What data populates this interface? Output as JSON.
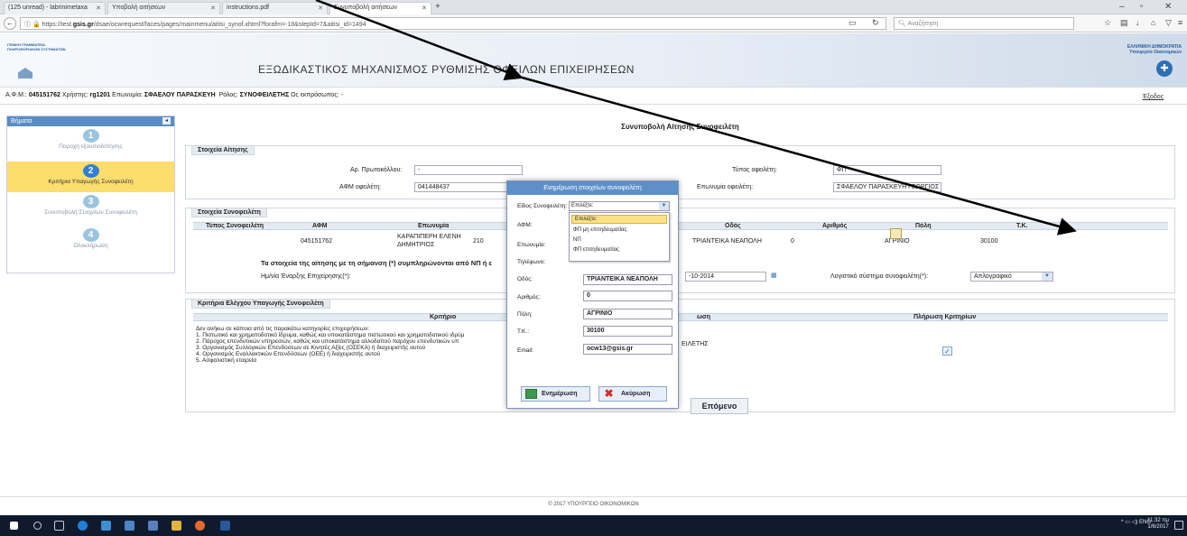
{
  "browser": {
    "tabs": [
      {
        "label": "(125 unread) - labrinimetaxa",
        "active": false
      },
      {
        "label": "Υποβολή αιτήσεων",
        "active": false
      },
      {
        "label": "instructions.pdf",
        "active": false
      },
      {
        "label": "Συνυποβολή αιτήσεων",
        "active": true
      }
    ],
    "url_prefix": "https://test.",
    "url_domain": "gsis.gr",
    "url_path": "/dsae/ocwrequest/faces/pages/mainmenu/aitisi_synof.xhtml?forafm=-18&stepId=7&aitisi_id=1494",
    "search_placeholder": "Αναζήτηση"
  },
  "header": {
    "left_logo_line1": "ΓΕΝΙΚΗ ΓΡΑΜΜΑΤΕΙΑ",
    "left_logo_line2": "ΠΛΗΡΟΦΟΡΙΑΚΩΝ ΣΥΣΤΗΜΑΤΩΝ",
    "title": "ΕΞΩΔΙΚΑΣΤΙΚΟΣ ΜΗΧΑΝΙΣΜΟΣ ΡΥΘΜΙΣΗΣ ΟΦΕΙΛΩΝ ΕΠΙΧΕΙΡΗΣΕΩΝ",
    "right_logo_line1": "ΕΛΛΗΝΙΚΗ ΔΗΜΟΚΡΑΤΙΑ",
    "right_logo_line2": "Υπουργείο Οικονομικών"
  },
  "userbar": {
    "afm_label": "Α.Φ.Μ.:",
    "afm": "045151762",
    "user_label": "Χρήστης:",
    "user": "rg1201",
    "name_label": "Επωνυμία:",
    "name": "ΣΦΑΕΛΟΥ ΠΑΡΑΣΚΕΥΗ",
    "role_label": "Ρόλος:",
    "role": "ΣΥΝΟΦΕΙΛΕΤΗΣ",
    "rep_label": "Ως εκπρόσωπος: -",
    "logout": "Έξοδος"
  },
  "steps": {
    "title": "Βήματα",
    "items": [
      {
        "num": "1",
        "label": "Παροχή εξουσιοδότησης"
      },
      {
        "num": "2",
        "label": "Κριτήρια Υπαγωγής Συνοφειλέτη"
      },
      {
        "num": "3",
        "label": "Συνυποβολή Στοιχείων Συνοφειλέτη"
      },
      {
        "num": "4",
        "label": "Ολοκλήρωση"
      }
    ],
    "current": 2
  },
  "main": {
    "title": "Συνυποβολή Αίτησης Συνοφειλέτη",
    "application": {
      "heading": "Στοιχεία Αίτησης",
      "protocol_label": "Αρ. Πρωτοκόλλου:",
      "protocol_value": "-",
      "debtor_type_label": "Τύπος οφειλέτη:",
      "debtor_type_value": "ΦΠ",
      "debtor_afm_label": "ΑΦΜ οφειλέτη:",
      "debtor_afm_value": "041448437",
      "debtor_name_label": "Επωνυμία οφειλέτη:",
      "debtor_name_value": "ΣΦΑΕΛΟΥ ΠΑΡΑΣΚΕΥΗ ΓΕΩΡΓΙΟΣ"
    },
    "codebtor": {
      "heading": "Στοιχεία Συνοφειλέτη",
      "columns": [
        "Τύπος Συνοφειλέτη",
        "ΑΦΜ",
        "Επωνυμία",
        "Οδός",
        "Αριθμός",
        "Πόλη",
        "Τ.Κ."
      ],
      "row": {
        "type": "",
        "afm": "045151762",
        "name_line1": "ΚΑΡΑΠΙΠΕΡΗ ΕΛΕΝΗ",
        "name_line2": "ΔΗΜΗΤΡΙΟΣ",
        "phone_partial": "210",
        "street": "ΤΡΙΑΝΤΕΙΚΑ ΝΕΑΠΟΛΗ",
        "number": "0",
        "city": "ΑΓΡΙΝΙΟ",
        "zip": "30100"
      },
      "note": "Τα στοιχεία της αίτησης με τη σήμανση (*) συμπληρώνονται από ΝΠ ή ε",
      "start_date_label": "Ημ/νία Έναρξης Επιχείρησης(*):",
      "start_date_value": "-10-2014",
      "accounting_label": "Λογιστικό σύστημα συνοφειλέτη(*):",
      "accounting_value": "Απλογραφικό"
    },
    "criteria": {
      "heading": "Κριτήρια Ελέγχου Υπαγωγής Συνοφειλέτη",
      "col_criterion": "Κριτήριο",
      "col_partial": "ωση",
      "col_fulfil": "Πλήρωση Κριτηρίων",
      "lines": [
        "Δεν ανήκω σε κάποια από τις παρακάτω κατηγορίες επιχειρήσεων:",
        "1. Πιστωτικό και χρηματοδοτικό ίδρυμα, καθώς και υποκατάστημα πιστωτικού και χρηματοδοτικού ιδρύμ",
        "2. Πάροχος επενδυτικών υπηρεσιών, καθώς και υποκατάστημα αλλοδαπού παρόχου επενδυτικών υπ",
        "3. Οργανισμός Συλλογικών Επενδύσεων σε Κινητές Αξίες (ΟΣΕΚΑ) ή διαχειριστής αυτού",
        "4. Οργανισμός Εναλλακτικών Επενδύσεων (ΟΕΕ) ή διαχειριστής αυτού",
        "5. Ασφαλιστική εταιρεία"
      ],
      "partial_value": "ΕΙΛΕΤΗΣ"
    },
    "next_button": "Επόμενο"
  },
  "modal": {
    "title": "Ενημέρωση στοιχείων συνοφειλέτη",
    "type_label": "Είδος Συνοφειλέτη:",
    "type_selected": "Επιλέξτε:",
    "type_options": [
      "Επιλέξτε:",
      "ΦΠ μη επιτηδευματίας",
      "ΝΠ",
      "ΦΠ επιτηδευματίας"
    ],
    "afm_label": "ΑΦΜ:",
    "name_label": "Επωνυμία:",
    "phone_label": "Τηλέφωνο:",
    "street_label": "Οδός:",
    "street_value": "ΤΡΙΑΝΤΕΙΚΑ ΝΕΑΠΟΛΗ",
    "number_label": "Αριθμός:",
    "number_value": "0",
    "city_label": "Πόλη:",
    "city_value": "ΑΓΡΙΝΙΟ",
    "zip_label": "Τ.Κ.:",
    "zip_value": "30100",
    "email_label": "Email:",
    "email_value": "ocw13@gsis.gr",
    "update_button": "Ενημέρωση",
    "cancel_button": "Ακύρωση"
  },
  "footer": "© 2017 ΥΠΟΥΡΓΕΙΟ ΟΙΚΟΝΟΜΙΚΩΝ",
  "taskbar": {
    "lang": "ENG",
    "time": "11:32 πμ",
    "date": "1/6/2017"
  },
  "colors": {
    "header_blue": "#5e90c8",
    "step_current": "#fddd6e",
    "taskbar": "#0f1a2f"
  }
}
